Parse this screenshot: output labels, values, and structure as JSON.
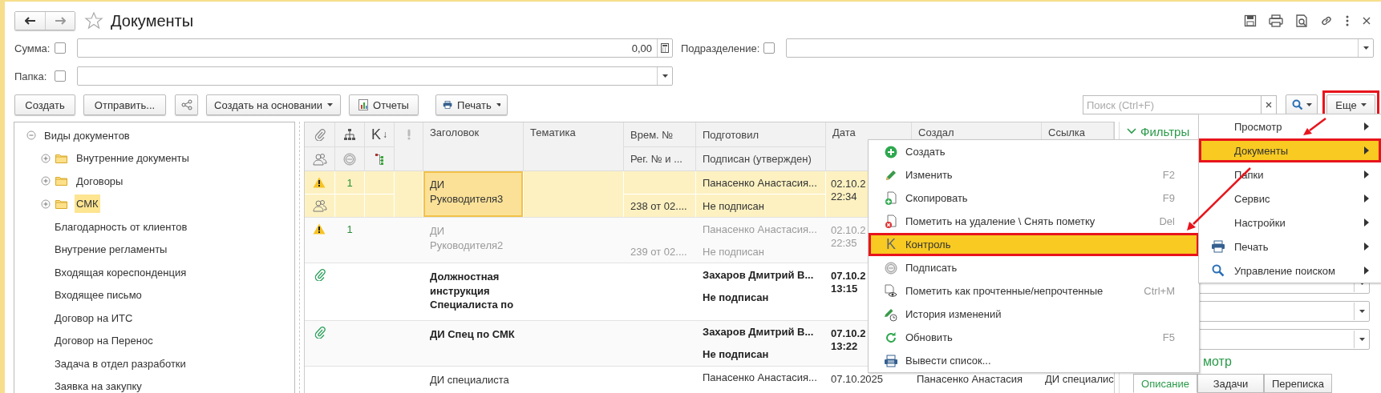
{
  "window": {
    "title": "Документы",
    "favorite": false
  },
  "fields": [
    {
      "label": "Сумма:",
      "checked": false,
      "kind": "number",
      "value": "0,00"
    },
    {
      "label": "Подразделение:",
      "checked": false,
      "kind": "select"
    },
    {
      "label": "Папка:",
      "checked": false,
      "kind": "select"
    }
  ],
  "toolbar": [
    {
      "kind": "text",
      "label": "Создать"
    },
    {
      "kind": "text",
      "label": "Отправить..."
    },
    {
      "kind": "share"
    },
    {
      "kind": "menu",
      "label": "Создать на основании"
    },
    {
      "kind": "report",
      "label": "Отчеты"
    },
    {
      "kind": "print",
      "label": "Печать"
    }
  ],
  "search": {
    "placeholder": "Поиск (Ctrl+F)"
  },
  "more_button": {
    "label": "Еще",
    "highlighted": true
  },
  "tree": {
    "label": "Виды документов",
    "expanded": true,
    "children": [
      {
        "label": "Внутренние документы",
        "kind": "folder",
        "expanded": false,
        "selected": false
      },
      {
        "label": "Договоры",
        "kind": "folder",
        "expanded": false,
        "selected": false
      },
      {
        "label": "СМК",
        "kind": "folder",
        "expanded": false,
        "selected": true
      },
      {
        "label": "Благодарность от клиентов",
        "kind": "item",
        "selected": false
      },
      {
        "label": "Внутрение регламенты",
        "kind": "item",
        "selected": false
      },
      {
        "label": "Входящая кореспонденция",
        "kind": "item",
        "selected": false
      },
      {
        "label": "Входящее письмо",
        "kind": "item",
        "selected": false
      },
      {
        "label": "Договор на ИТС",
        "kind": "item",
        "selected": false
      },
      {
        "label": "Договор на Перенос",
        "kind": "item",
        "selected": false
      },
      {
        "label": "Задача в отдел разработки",
        "kind": "item",
        "selected": false
      },
      {
        "label": "Заявка на закупку",
        "kind": "item",
        "selected": false
      }
    ]
  },
  "table": {
    "control_header": "K",
    "sort_mark": "↓",
    "columns": [
      {
        "top": "Заголовок"
      },
      {
        "top": "Тематика"
      },
      {
        "top": "Врем. №",
        "bottom": "Рег. № и ..."
      },
      {
        "top": "Подготовил",
        "bottom": "Подписан (утвержден)"
      },
      {
        "top": "Дата"
      },
      {
        "top": "Создал"
      },
      {
        "top": "Ссылка"
      }
    ],
    "rows": [
      {
        "selected": true,
        "dimmed": false,
        "bold": false,
        "warning": true,
        "attachment": false,
        "group": true,
        "count": "1",
        "title": "ДИ\nРуководителя3",
        "focused": true,
        "reg": "238 от 02....",
        "prepared": "Панасенко Анастасия...",
        "signed": "Не подписан",
        "date": "02.10.2",
        "time": "22:34"
      },
      {
        "selected": false,
        "dimmed": true,
        "bold": false,
        "warning": true,
        "attachment": false,
        "group": false,
        "count": "1",
        "title": "ДИ\nРуководителя2",
        "focused": false,
        "reg": "239 от 02....",
        "prepared": "Панасенко Анастасия...",
        "signed": "Не подписан",
        "date": "02.10.2",
        "time": "22:35"
      },
      {
        "selected": false,
        "dimmed": false,
        "bold": true,
        "warning": false,
        "attachment": true,
        "group": false,
        "title": "Должностная инструкция Специалиста по",
        "focused": false,
        "prepared": "Захаров Дмитрий В...",
        "signed": "Не подписан",
        "date": "07.10.2",
        "time": "13:15"
      },
      {
        "selected": false,
        "dimmed": false,
        "bold": true,
        "warning": false,
        "attachment": true,
        "group": false,
        "title": "ДИ Спец по СМК",
        "focused": false,
        "prepared": "Захаров Дмитрий В...",
        "signed": "Не подписан",
        "date": "07.10.2",
        "time": "13:22"
      },
      {
        "selected": false,
        "dimmed": false,
        "bold": false,
        "warning": false,
        "attachment": false,
        "group": false,
        "title": "ДИ специалиста",
        "focused": false,
        "prepared": "Панасенко Анастасия...",
        "date": "07.10.2025",
        "created": "Панасенко Анастасия",
        "link": "ДИ специалис"
      }
    ]
  },
  "filters": {
    "title": "Фильтры",
    "expanded": true,
    "fields": [
      {
        "kind": "select"
      },
      {
        "kind": "select"
      },
      {
        "kind": "select"
      }
    ]
  },
  "preview": {
    "heading": "мотр",
    "tabs": [
      {
        "label": "Описание",
        "selected": true
      },
      {
        "label": "Задачи",
        "selected": false
      },
      {
        "label": "Переписка",
        "selected": false
      }
    ]
  },
  "more_menu": [
    {
      "label": "Просмотр",
      "kind": "plain",
      "selected": false,
      "highlighted": false
    },
    {
      "label": "Документы",
      "kind": "plain",
      "selected": true,
      "highlighted": true
    },
    {
      "label": "Папки",
      "kind": "plain",
      "selected": false,
      "highlighted": false
    },
    {
      "label": "Сервис",
      "kind": "plain",
      "selected": false,
      "highlighted": false
    },
    {
      "label": "Настройки",
      "kind": "plain",
      "selected": false,
      "highlighted": false
    },
    {
      "label": "Печать",
      "kind": "print",
      "selected": false,
      "highlighted": false
    },
    {
      "label": "Управление поиском",
      "kind": "search",
      "selected": false,
      "highlighted": false
    }
  ],
  "documents_menu": [
    {
      "kind": "plus",
      "label": "Создать",
      "selected": false,
      "highlighted": false
    },
    {
      "kind": "pencil",
      "label": "Изменить",
      "shortcut": "F2",
      "selected": false,
      "highlighted": false
    },
    {
      "kind": "copy",
      "label": "Скопировать",
      "shortcut": "F9",
      "selected": false,
      "highlighted": false
    },
    {
      "kind": "delete",
      "label": "Пометить на удаление \\ Снять пометку",
      "shortcut": "Del",
      "selected": false,
      "highlighted": false
    },
    {
      "kind": "letter",
      "glyph": "K",
      "label": "Контроль",
      "selected": true,
      "highlighted": true
    },
    {
      "kind": "sign",
      "label": "Подписать",
      "selected": false,
      "highlighted": false
    },
    {
      "kind": "read",
      "label": "Пометить как прочтенные/непрочтенные",
      "shortcut": "Ctrl+M",
      "selected": false,
      "highlighted": false
    },
    {
      "kind": "history",
      "label": "История изменений",
      "selected": false,
      "highlighted": false
    },
    {
      "kind": "refresh",
      "label": "Обновить",
      "shortcut": "F5",
      "selected": false,
      "highlighted": false
    },
    {
      "kind": "list",
      "label": "Вывести список...",
      "selected": false,
      "highlighted": false
    }
  ]
}
